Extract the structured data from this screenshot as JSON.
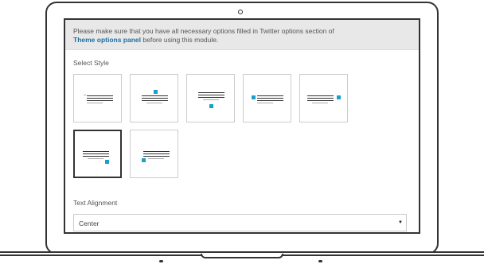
{
  "notice": {
    "text_before": "Please make sure that you have all necessary options filled in Twitter options section of",
    "link": "Theme options panel",
    "text_after": "before using this module."
  },
  "select_style": {
    "label": "Select Style",
    "options": [
      {
        "name": "style-1",
        "selected": false
      },
      {
        "name": "style-2",
        "selected": false
      },
      {
        "name": "style-3",
        "selected": false
      },
      {
        "name": "style-4",
        "selected": false
      },
      {
        "name": "style-5",
        "selected": false
      },
      {
        "name": "style-6",
        "selected": true
      },
      {
        "name": "style-7",
        "selected": false
      }
    ]
  },
  "text_alignment": {
    "label": "Text Alignment",
    "value": "Center"
  },
  "colors": {
    "accent": "#1aa0c8",
    "link": "#1a6fa0",
    "notice_bg": "#e8e8e8"
  }
}
